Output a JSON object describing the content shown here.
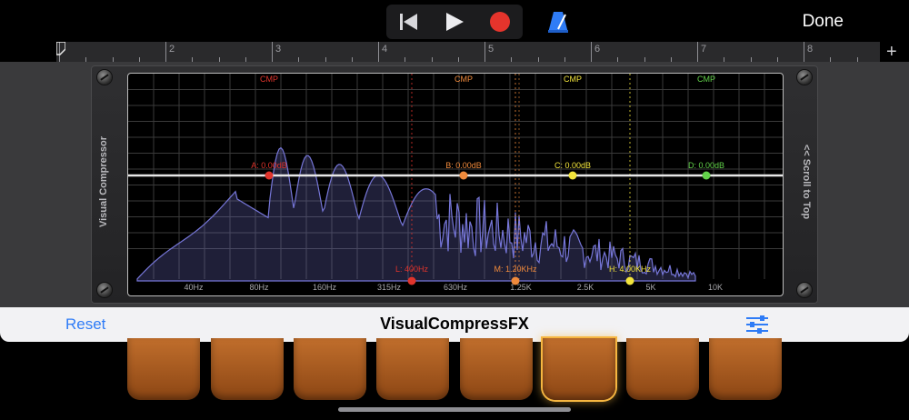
{
  "transport": {
    "rewind_icon": "skip-to-start-icon",
    "play_icon": "play-icon",
    "record_icon": "record-icon",
    "metronome_icon": "metronome-icon",
    "record_color": "#e5342c",
    "metronome_color": "#2f7cf6"
  },
  "done_label": "Done",
  "ruler": {
    "bars": [
      "2",
      "3",
      "4",
      "5",
      "6",
      "7",
      "8"
    ],
    "add_label": "+"
  },
  "plugin": {
    "left_label": "Visual Compressor",
    "right_label": "<< Scroll to Top",
    "bands": [
      {
        "label": "CMP",
        "color": "#e0342c",
        "gain_label": "A: 0.00dB"
      },
      {
        "label": "CMP",
        "color": "#f08a3c",
        "gain_label": "B: 0.00dB"
      },
      {
        "label": "CMP",
        "color": "#f2e43c",
        "gain_label": "C: 0.00dB"
      },
      {
        "label": "CMP",
        "color": "#62d24a",
        "gain_label": "D: 0.00dB"
      }
    ],
    "crossovers": [
      {
        "label": "L: 400Hz",
        "color": "#e0342c"
      },
      {
        "label": "M: 1.20KHz",
        "color": "#f08a3c"
      },
      {
        "label": "H: 4.00KHz",
        "color": "#f2e43c"
      }
    ],
    "freq_labels": [
      "40Hz",
      "80Hz",
      "160Hz",
      "315Hz",
      "630Hz",
      "1.25K",
      "2.5K",
      "5K",
      "10K"
    ]
  },
  "bottom_bar": {
    "reset_label": "Reset",
    "title": "VisualCompressFX",
    "settings_icon": "sliders-icon"
  },
  "pads": {
    "count": 8,
    "active_index": 5
  }
}
